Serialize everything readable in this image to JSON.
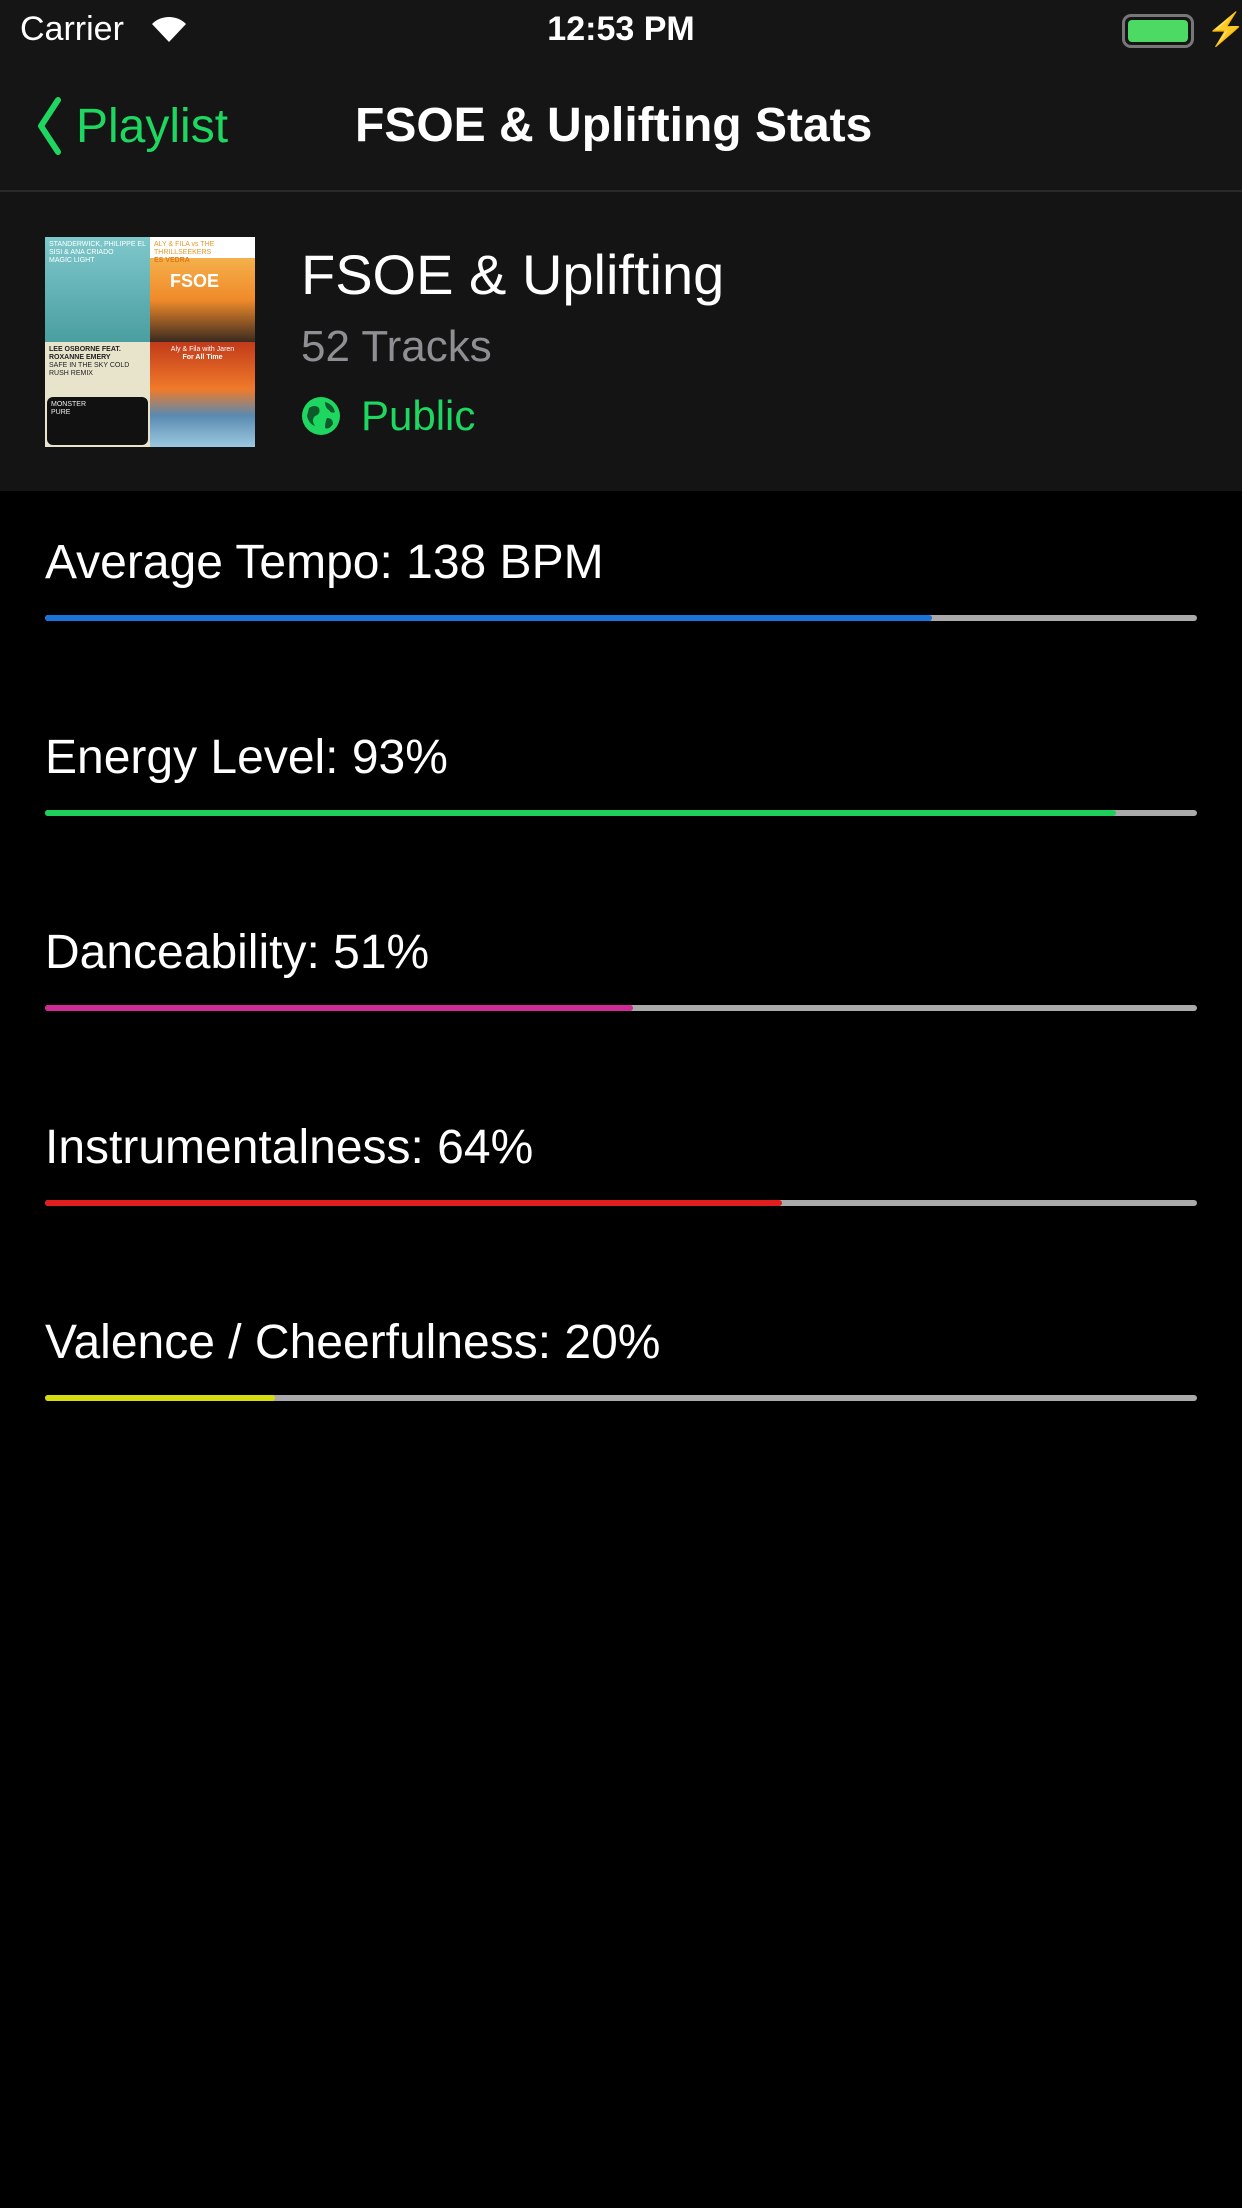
{
  "status_bar": {
    "carrier": "Carrier",
    "time": "12:53 PM"
  },
  "nav": {
    "back_label": "Playlist",
    "title": "FSOE & Uplifting Stats"
  },
  "playlist": {
    "name": "FSOE & Uplifting",
    "tracks": "52 Tracks",
    "visibility": "Public",
    "covers": [
      {
        "artist": "STANDERWICK, PHILIPPE EL SISI & ANA CRIADO",
        "title": "MAGIC LIGHT"
      },
      {
        "artist": "ALY & FILA vs THE THRILLSEEKERS",
        "title": "ES VEDRA",
        "logo": "FSOE"
      },
      {
        "artist": "LEE OSBORNE FEAT. ROXANNE EMERY",
        "title": "SAFE IN THE SKY COLD RUSH REMIX",
        "artist2": "MONSTER",
        "title2": "PURE"
      },
      {
        "artist": "Aly & Fila with Jaren",
        "title": "For All Time"
      }
    ]
  },
  "stats": [
    {
      "label": "Average Tempo: 138 BPM",
      "value": 0.77,
      "color": "#1a74d8"
    },
    {
      "label": "Energy Level: 93%",
      "value": 0.93,
      "color": "#1ecf5c"
    },
    {
      "label": "Danceability: 51%",
      "value": 0.51,
      "color": "#d02a96"
    },
    {
      "label": "Instrumentalness: 64%",
      "value": 0.64,
      "color": "#e01e1e"
    },
    {
      "label": "Valence / Cheerfulness: 20%",
      "value": 0.2,
      "color": "#d6dc10"
    }
  ]
}
